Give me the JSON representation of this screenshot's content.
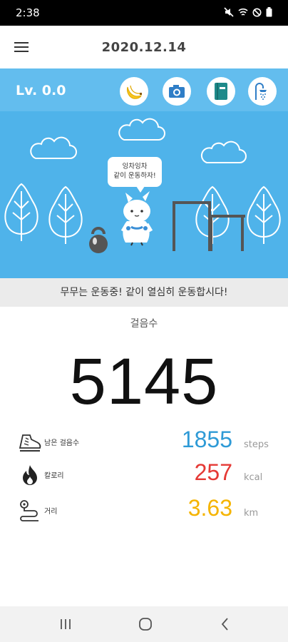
{
  "status_bar": {
    "time": "2:38",
    "icons": [
      "mute-icon",
      "wifi-icon",
      "dnd-icon",
      "battery-icon"
    ]
  },
  "app_bar": {
    "title": "2020.12.14",
    "menu_icon": "hamburger-menu-icon"
  },
  "scene": {
    "level": "Lv. 0.0",
    "buttons": [
      "banana-icon",
      "camera-icon",
      "book-icon",
      "shower-icon"
    ],
    "speech_line1": "잉차잉차",
    "speech_line2": "같이 운동하자!",
    "colors": {
      "sky": "#4fb3ea",
      "topbar": "#63bdee"
    }
  },
  "message": "무무는 운동중! 같이 열심히 운동합시다!",
  "steps": {
    "label": "걸음수",
    "count": "5145"
  },
  "stats": [
    {
      "label": "남은 걸음수",
      "value": "1855",
      "unit": "steps",
      "icon": "shoe-icon",
      "color": "#2e9ad6"
    },
    {
      "label": "칼로리",
      "value": "257",
      "unit": "kcal",
      "icon": "flame-icon",
      "color": "#e53935"
    },
    {
      "label": "거리",
      "value": "3.63",
      "unit": "km",
      "icon": "route-icon",
      "color": "#f5b400"
    }
  ],
  "nav": [
    "recent-apps-icon",
    "home-icon",
    "back-icon"
  ]
}
